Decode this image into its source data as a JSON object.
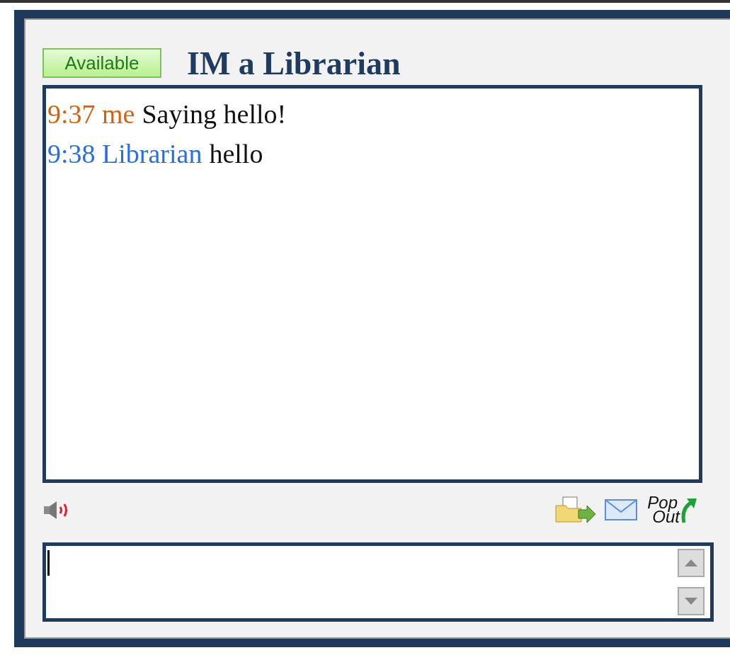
{
  "status": {
    "label": "Available"
  },
  "title": "IM a Librarian",
  "messages": [
    {
      "time": "9:37",
      "sender": "me",
      "text": "Saying hello!",
      "kind": "self"
    },
    {
      "time": "9:38",
      "sender": "Librarian",
      "text": "hello",
      "kind": "other"
    }
  ],
  "toolbar": {
    "pop_out": [
      "Pop",
      "Out"
    ]
  }
}
